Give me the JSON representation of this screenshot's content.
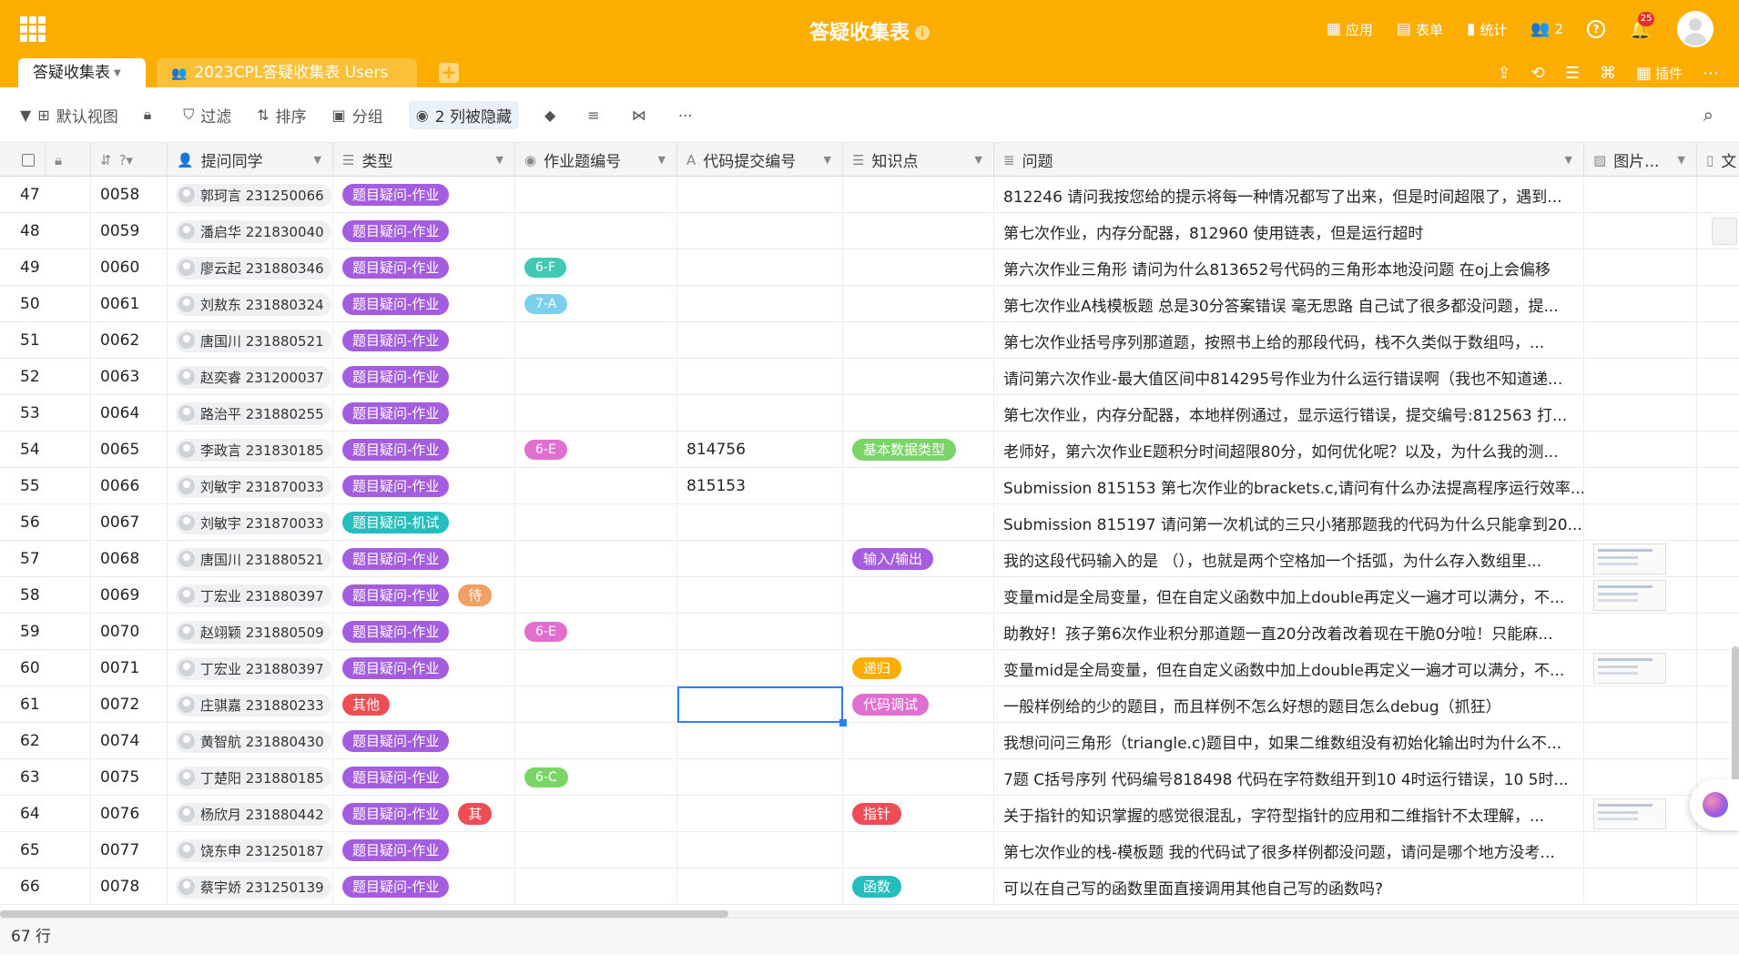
{
  "header": {
    "title": "答疑收集表",
    "right_items": [
      {
        "icon": "apps-icon",
        "label": "应用"
      },
      {
        "icon": "form-icon",
        "label": "表单"
      },
      {
        "icon": "stats-icon",
        "label": "统计"
      },
      {
        "icon": "members-icon",
        "label": "2"
      }
    ],
    "notification_count": "25",
    "help": "?"
  },
  "tabs": {
    "active": "答疑收集表",
    "second": "2023CPL答疑收集表 Users",
    "right_plugin_label": "插件"
  },
  "toolbar": {
    "view": "默认视图",
    "filter": "过滤",
    "sort": "排序",
    "group": "分组",
    "hidden": "2 列被隐藏"
  },
  "columns": {
    "user": "提问同学",
    "type": "类型",
    "hw": "作业题编号",
    "code": "代码提交编号",
    "kp": "知识点",
    "q": "问题",
    "img": "图片...",
    "doc": "文"
  },
  "colors": {
    "brand": "#fbae00",
    "hw_tag": "#a55de0",
    "exam_tag": "#26bdbd",
    "other_tag": "#ef4d55",
    "selection": "#2d7ff9"
  },
  "rows": [
    {
      "idx": "47",
      "no": "0058",
      "user": "郭珂言 231250066",
      "type": "题目疑问-作业",
      "hw": "",
      "code": "",
      "kp": "",
      "q": "812246 请问我按您给的提示将每一种情况都写了出来，但是时间超限了，遇到...",
      "img": false
    },
    {
      "idx": "48",
      "no": "0059",
      "user": "潘启华 221830040",
      "type": "题目疑问-作业",
      "hw": "",
      "code": "",
      "kp": "",
      "q": "第七次作业，内存分配器，812960 使用链表，但是运行超时",
      "img": false,
      "doc": true
    },
    {
      "idx": "49",
      "no": "0060",
      "user": "廖云起 231880346",
      "type": "题目疑问-作业",
      "hw": "6-F",
      "hwColor": "#41c9b4",
      "code": "",
      "kp": "",
      "q": "第六次作业三角形 请问为什么813652号代码的三角形本地没问题 在oj上会偏移",
      "img": false
    },
    {
      "idx": "50",
      "no": "0061",
      "user": "刘敖东 231880324",
      "type": "题目疑问-作业",
      "hw": "7-A",
      "hwColor": "#7ccfef",
      "code": "",
      "kp": "",
      "q": "第七次作业A栈模板题 总是30分答案错误 毫无思路 自己试了很多都没问题，提...",
      "img": false
    },
    {
      "idx": "51",
      "no": "0062",
      "user": "唐国川 231880521",
      "type": "题目疑问-作业",
      "hw": "",
      "code": "",
      "kp": "",
      "q": "第七次作业括号序列那道题，按照书上给的那段代码，栈不久类似于数组吗，...",
      "img": false
    },
    {
      "idx": "52",
      "no": "0063",
      "user": "赵奕睿 231200037",
      "type": "题目疑问-作业",
      "hw": "",
      "code": "",
      "kp": "",
      "q": "请问第六次作业-最大值区间中814295号作业为什么运行错误啊（我也不知道递...",
      "img": false
    },
    {
      "idx": "53",
      "no": "0064",
      "user": "路治平 231880255",
      "type": "题目疑问-作业",
      "hw": "",
      "code": "",
      "kp": "",
      "q": "第七次作业，内存分配器，本地样例通过，显示运行错误，提交编号:812563 打...",
      "img": false
    },
    {
      "idx": "54",
      "no": "0065",
      "user": "李政言 231830185",
      "type": "题目疑问-作业",
      "hw": "6-E",
      "hwColor": "#e06fcf",
      "code": "814756",
      "kp": "基本数据类型",
      "kpColor": "#7bd468",
      "q": "老师好，第六次作业E题积分时间超限80分，如何优化呢？以及，为什么我的测...",
      "img": false
    },
    {
      "idx": "55",
      "no": "0066",
      "user": "刘敏宇 231870033",
      "type": "题目疑问-作业",
      "hw": "",
      "code": "815153",
      "kp": "",
      "q": "Submission 815153 第七次作业的brackets.c,请问有什么办法提高程序运行效率...",
      "img": false
    },
    {
      "idx": "56",
      "no": "0067",
      "user": "刘敏宇 231870033",
      "type": "题目疑问-机试",
      "typeKind": "exam",
      "hw": "",
      "code": "",
      "kp": "",
      "q": "Submission 815197 请问第一次机试的三只小猪那题我的代码为什么只能拿到20...",
      "img": false
    },
    {
      "idx": "57",
      "no": "0068",
      "user": "唐国川 231880521",
      "type": "题目疑问-作业",
      "hw": "",
      "code": "",
      "kp": "输入/输出",
      "kpColor": "#a55de0",
      "q": "我的这段代码输入的是 （），也就是两个空格加一个括弧，为什么存入数组里...",
      "img": true
    },
    {
      "idx": "58",
      "no": "0069",
      "user": "丁宏业 231880397",
      "type": "题目疑问-作业",
      "extra": "待",
      "extraKind": "pending",
      "hw": "",
      "code": "",
      "kp": "",
      "q": "变量mid是全局变量，但在自定义函数中加上double再定义一遍才可以满分，不...",
      "img": true
    },
    {
      "idx": "59",
      "no": "0070",
      "user": "赵翊颖 231880509",
      "type": "题目疑问-作业",
      "hw": "6-E",
      "hwColor": "#e06fcf",
      "code": "",
      "kp": "",
      "q": "助教好！孩子第6次作业积分那道题一直20分改着改着现在干脆0分啦！只能麻...",
      "img": false
    },
    {
      "idx": "60",
      "no": "0071",
      "user": "丁宏业 231880397",
      "type": "题目疑问-作业",
      "hw": "",
      "code": "",
      "kp": "递归",
      "kpColor": "#fbae00",
      "q": "变量mid是全局变量，但在自定义函数中加上double再定义一遍才可以满分，不...",
      "img": true
    },
    {
      "idx": "61",
      "no": "0072",
      "user": "庄骐嘉 231880233",
      "type": "其他",
      "typeKind": "other",
      "hw": "",
      "code": "",
      "kp": "代码调试",
      "kpColor": "#e06fcf",
      "q": "一般样例给的少的题目，而且样例不怎么好想的题目怎么debug（抓狂）",
      "img": false
    },
    {
      "idx": "62",
      "no": "0074",
      "user": "黄智航 231880430",
      "type": "题目疑问-作业",
      "hw": "",
      "code": "",
      "kp": "",
      "q": "我想问问三角形（triangle.c)题目中，如果二维数组没有初始化输出时为什么不...",
      "img": false
    },
    {
      "idx": "63",
      "no": "0075",
      "user": "丁楚阳 231880185",
      "type": "题目疑问-作业",
      "hw": "6-C",
      "hwColor": "#7bd468",
      "code": "",
      "kp": "",
      "q": "7题 C括号序列 代码编号818498 代码在字符数组开到10 4时运行错误，10 5时...",
      "img": false
    },
    {
      "idx": "64",
      "no": "0076",
      "user": "杨欣月 231880442",
      "type": "题目疑问-作业",
      "extra": "其",
      "extraKind": "other",
      "hw": "",
      "code": "",
      "kp": "指针",
      "kpColor": "#ef4d55",
      "q": "关于指针的知识掌握的感觉很混乱，字符型指针的应用和二维指针不太理解，...",
      "img": true
    },
    {
      "idx": "65",
      "no": "0077",
      "user": "饶东申 231250187",
      "type": "题目疑问-作业",
      "hw": "",
      "code": "",
      "kp": "",
      "q": "第七次作业的栈-模板题 我的代码试了很多样例都没问题，请问是哪个地方没考...",
      "img": false
    },
    {
      "idx": "66",
      "no": "0078",
      "user": "蔡宇娇 231250139",
      "type": "题目疑问-作业",
      "hw": "",
      "code": "",
      "kp": "函数",
      "kpColor": "#26bdbd",
      "q": "可以在自己写的函数里面直接调用其他自己写的函数吗?",
      "img": false
    }
  ],
  "footer": {
    "row_count": "67 行"
  }
}
